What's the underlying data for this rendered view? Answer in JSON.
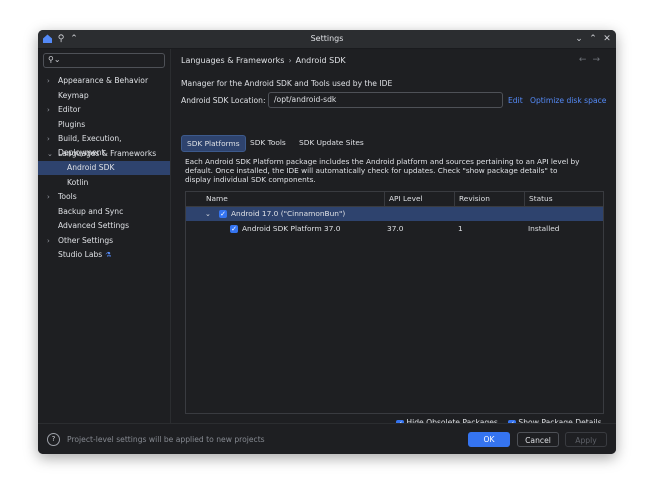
{
  "window": {
    "title": "Settings"
  },
  "sidebar": {
    "search_placeholder": "",
    "items": [
      {
        "label": "Appearance & Behavior",
        "expandable": true
      },
      {
        "label": "Keymap",
        "expandable": false
      },
      {
        "label": "Editor",
        "expandable": true
      },
      {
        "label": "Plugins",
        "expandable": false
      },
      {
        "label": "Build, Execution, Deployment",
        "expandable": true
      },
      {
        "label": "Languages & Frameworks",
        "expandable": true,
        "expanded": true
      },
      {
        "label": "Android SDK",
        "selected": true
      },
      {
        "label": "Kotlin"
      },
      {
        "label": "Tools",
        "expandable": true
      },
      {
        "label": "Backup and Sync"
      },
      {
        "label": "Advanced Settings"
      },
      {
        "label": "Other Settings",
        "expandable": true
      },
      {
        "label": "Studio Labs"
      }
    ]
  },
  "content": {
    "breadcrumb": [
      "Languages & Frameworks",
      "Android SDK"
    ],
    "description": "Manager for the Android SDK and Tools used by the IDE",
    "location_label": "Android SDK Location:",
    "location_value": "/opt/android-sdk",
    "edit_link": "Edit",
    "optimize_link": "Optimize disk space",
    "tabs": [
      "SDK Platforms",
      "SDK Tools",
      "SDK Update Sites"
    ],
    "platform_description": "Each Android SDK Platform package includes the Android platform and sources pertaining to an API level by default. Once installed, the IDE will automatically check for updates. Check \"show package details\" to display individual SDK components.",
    "table": {
      "columns": [
        "Name",
        "API Level",
        "Revision",
        "Status"
      ],
      "rows": [
        {
          "name": "Android 17.0 (\"CinnamonBun\")",
          "api": "",
          "revision": "",
          "status": "",
          "group": true
        },
        {
          "name": "Android SDK Platform 37.0",
          "api": "37.0",
          "revision": "1",
          "status": "Installed"
        }
      ]
    },
    "hide_obsolete": "Hide Obsolete Packages",
    "show_details": "Show Package Details"
  },
  "footer": {
    "note": "Project-level settings will be applied to new projects",
    "ok": "OK",
    "cancel": "Cancel",
    "apply": "Apply"
  },
  "colors": {
    "accent": "#3574f0",
    "selection": "#2e436e",
    "link": "#548af7",
    "background": "#1e1f22"
  }
}
